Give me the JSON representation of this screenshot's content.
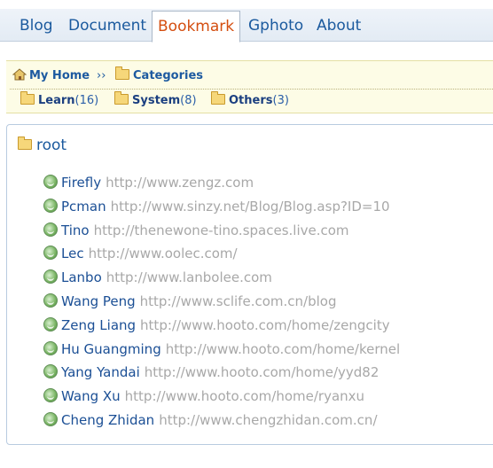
{
  "tabs": [
    {
      "label": "Blog"
    },
    {
      "label": "Document"
    },
    {
      "label": "Bookmark",
      "active": true
    },
    {
      "label": "Gphoto"
    },
    {
      "label": "About"
    }
  ],
  "breadcrumb": {
    "home": "My Home",
    "separator": "››",
    "categories": "Categories"
  },
  "categories": [
    {
      "name": "Learn",
      "count": "(16)"
    },
    {
      "name": "System",
      "count": "(8)"
    },
    {
      "name": "Others",
      "count": "(3)"
    }
  ],
  "root": {
    "title": "root",
    "bookmarks": [
      {
        "name": "Firefly",
        "url": "http://www.zengz.com"
      },
      {
        "name": "Pcman",
        "url": "http://www.sinzy.net/Blog/Blog.asp?ID=10"
      },
      {
        "name": "Tino",
        "url": "http://thenewone-tino.spaces.live.com"
      },
      {
        "name": "Lec",
        "url": "http://www.oolec.com/"
      },
      {
        "name": "Lanbo",
        "url": "http://www.lanbolee.com"
      },
      {
        "name": "Wang Peng",
        "url": "http://www.sclife.com.cn/blog"
      },
      {
        "name": "Zeng Liang",
        "url": "http://www.hooto.com/home/zengcity"
      },
      {
        "name": "Hu Guangming",
        "url": "http://www.hooto.com/home/kernel"
      },
      {
        "name": "Yang Yandai",
        "url": "http://www.hooto.com/home/yyd82"
      },
      {
        "name": "Wang Xu",
        "url": "http://www.hooto.com/home/ryanxu"
      },
      {
        "name": "Cheng Zhidan",
        "url": "http://www.chengzhidan.com.cn/"
      }
    ]
  },
  "colors": {
    "link": "#1b5a9e",
    "active_tab": "#d44e10",
    "panel_bg": "#fdfce6",
    "url": "#a8a8a8"
  },
  "icons": {
    "home": "home-icon",
    "folder": "folder-icon",
    "bookmark": "globe-bookmark-icon"
  }
}
